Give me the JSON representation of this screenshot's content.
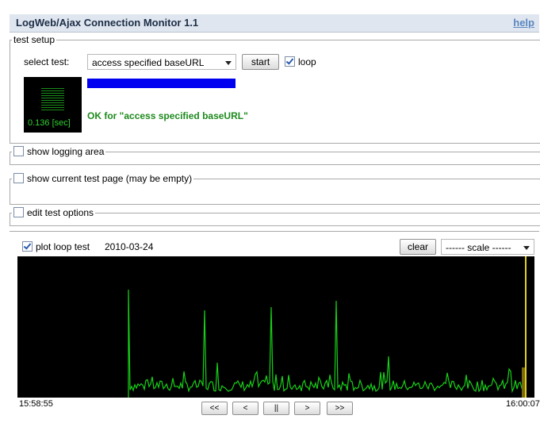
{
  "app": {
    "title": "LogWeb/Ajax Connection Monitor 1.1",
    "help": "help"
  },
  "setup": {
    "legend": "test setup",
    "select_label": "select test:",
    "selected_test": "access specified baseURL",
    "start": "start",
    "loop_label": "loop",
    "loop_checked": true,
    "timer_value": "0.136 [sec]",
    "status": "OK for \"access specified baseURL\"",
    "progress": 1.0
  },
  "sections": {
    "logging": "show logging area",
    "testpage": "show current test page (may be empty)",
    "options": "edit test options"
  },
  "plot": {
    "checkbox_label": "plot loop test",
    "date": "2010-03-24",
    "clear": "clear",
    "scale": "------ scale ------",
    "start_time": "15:58:55",
    "end_time": "16:00:07",
    "nav": [
      "<<",
      "<",
      "||",
      ">",
      ">>"
    ]
  },
  "colors": {
    "plot_line": "#18d018",
    "marker": "#e0d020",
    "status": "#1d8a1d",
    "progress": "#0000f0"
  }
}
